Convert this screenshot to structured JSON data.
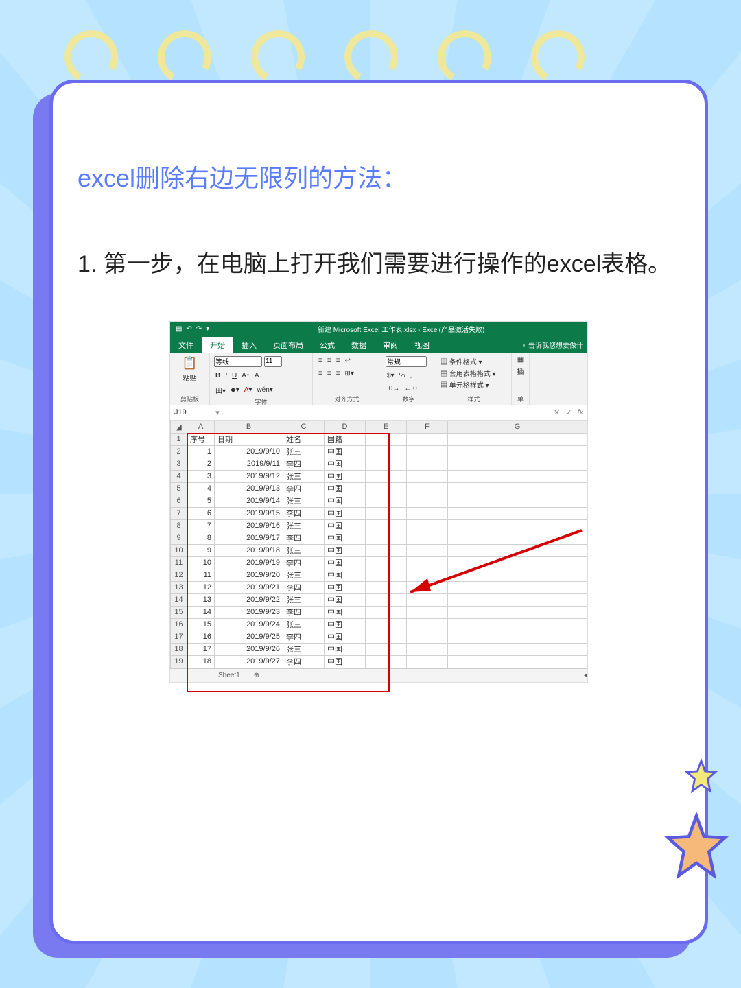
{
  "page": {
    "title": "excel删除右边无限列的方法：",
    "step1": "1. 第一步，在电脑上打开我们需要进行操作的excel表格。"
  },
  "excel": {
    "windowTitle": "新建 Microsoft Excel 工作表.xlsx - Excel(产品激活失败)",
    "tabs": {
      "file": "文件",
      "home": "开始",
      "insert": "插入",
      "layout": "页面布局",
      "formulas": "公式",
      "data": "数据",
      "review": "审阅",
      "view": "视图",
      "tell": "♀ 告诉我您想要做什"
    },
    "ribbon": {
      "clipboard": {
        "paste": "粘贴",
        "label": "剪贴板"
      },
      "font": {
        "name": "等线",
        "size": "11",
        "label": "字体"
      },
      "align": {
        "label": "对齐方式"
      },
      "number": {
        "format": "常规",
        "label": "数字"
      },
      "styles": {
        "cond": "条件格式",
        "tbl": "套用表格格式",
        "cell": "单元格样式",
        "label": "样式"
      },
      "cells": {
        "ins": "插",
        "label": "单"
      }
    },
    "namebox": "J19",
    "fx": "fx",
    "columns": [
      "A",
      "B",
      "C",
      "D",
      "E",
      "F",
      "G"
    ],
    "header": {
      "a": "序号",
      "b": "日期",
      "c": "姓名",
      "d": "国籍"
    },
    "rows": [
      {
        "n": "1",
        "a": "1",
        "b": "2019/9/10",
        "c": "张三",
        "d": "中国"
      },
      {
        "n": "2",
        "a": "2",
        "b": "2019/9/11",
        "c": "李四",
        "d": "中国"
      },
      {
        "n": "3",
        "a": "3",
        "b": "2019/9/12",
        "c": "张三",
        "d": "中国"
      },
      {
        "n": "4",
        "a": "4",
        "b": "2019/9/13",
        "c": "李四",
        "d": "中国"
      },
      {
        "n": "5",
        "a": "5",
        "b": "2019/9/14",
        "c": "张三",
        "d": "中国"
      },
      {
        "n": "6",
        "a": "6",
        "b": "2019/9/15",
        "c": "李四",
        "d": "中国"
      },
      {
        "n": "7",
        "a": "7",
        "b": "2019/9/16",
        "c": "张三",
        "d": "中国"
      },
      {
        "n": "8",
        "a": "8",
        "b": "2019/9/17",
        "c": "李四",
        "d": "中国"
      },
      {
        "n": "9",
        "a": "9",
        "b": "2019/9/18",
        "c": "张三",
        "d": "中国"
      },
      {
        "n": "10",
        "a": "10",
        "b": "2019/9/19",
        "c": "李四",
        "d": "中国"
      },
      {
        "n": "11",
        "a": "11",
        "b": "2019/9/20",
        "c": "张三",
        "d": "中国"
      },
      {
        "n": "12",
        "a": "12",
        "b": "2019/9/21",
        "c": "李四",
        "d": "中国"
      },
      {
        "n": "13",
        "a": "13",
        "b": "2019/9/22",
        "c": "张三",
        "d": "中国"
      },
      {
        "n": "14",
        "a": "14",
        "b": "2019/9/23",
        "c": "李四",
        "d": "中国"
      },
      {
        "n": "15",
        "a": "15",
        "b": "2019/9/24",
        "c": "张三",
        "d": "中国"
      },
      {
        "n": "16",
        "a": "16",
        "b": "2019/9/25",
        "c": "李四",
        "d": "中国"
      },
      {
        "n": "17",
        "a": "17",
        "b": "2019/9/26",
        "c": "张三",
        "d": "中国"
      },
      {
        "n": "18",
        "a": "18",
        "b": "2019/9/27",
        "c": "李四",
        "d": "中国"
      }
    ],
    "sheet": "Sheet1",
    "addSheet": "⊕"
  }
}
